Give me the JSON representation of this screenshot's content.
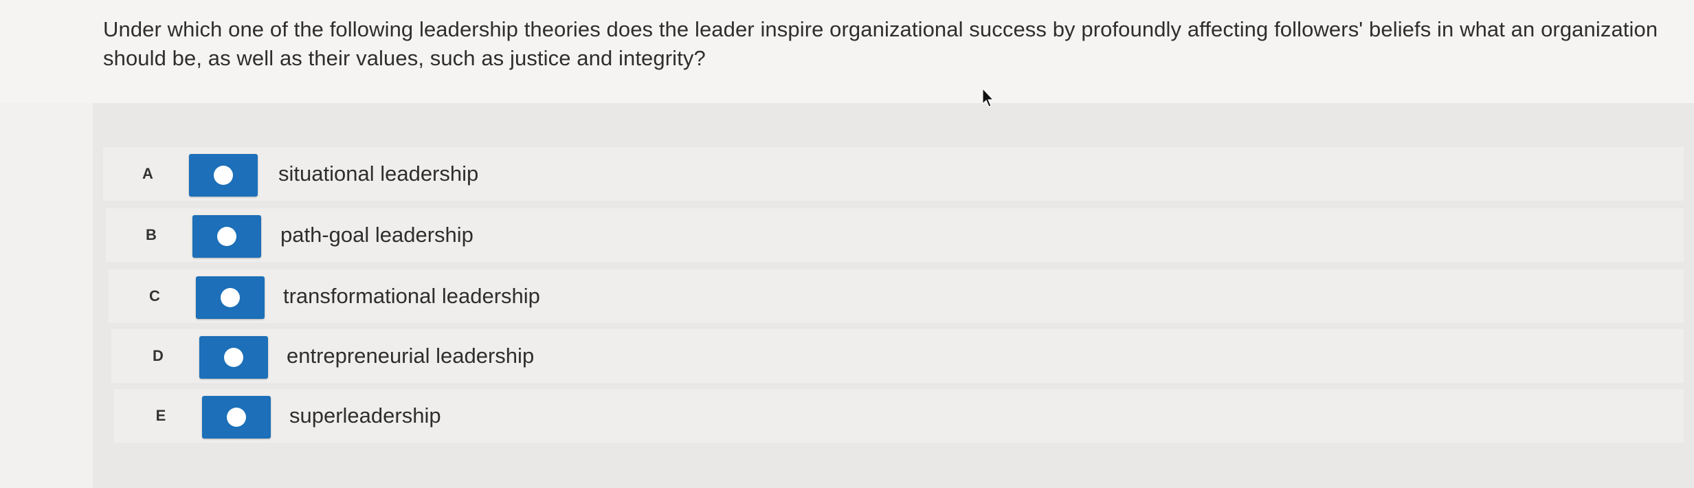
{
  "question": {
    "text": "Under which one of the following leadership theories does the leader inspire organizational success by profoundly affecting followers' beliefs in what an organization should be, as well as their values, such as justice and integrity?"
  },
  "choices": [
    {
      "letter": "A",
      "label": "situational leadership"
    },
    {
      "letter": "B",
      "label": "path-goal leadership"
    },
    {
      "letter": "C",
      "label": "transformational leadership"
    },
    {
      "letter": "D",
      "label": "entrepreneurial leadership"
    },
    {
      "letter": "E",
      "label": "superleadership"
    }
  ],
  "colors": {
    "radio_button": "#1c6fb8",
    "radio_dot": "#ffffff"
  },
  "icons": {
    "cursor": "mouse-pointer-icon"
  }
}
